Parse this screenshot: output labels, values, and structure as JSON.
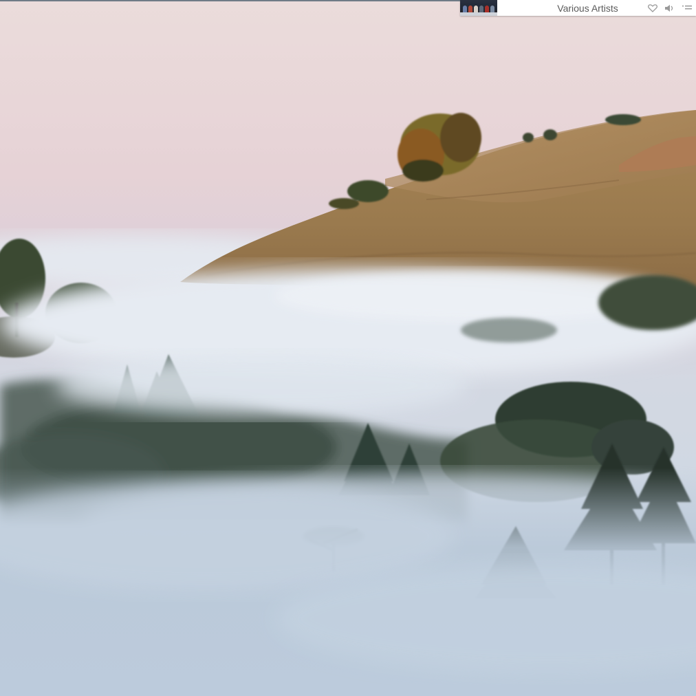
{
  "wallpaper": {
    "description_icon": "landscape-photo-icon"
  },
  "mini_player": {
    "artist": "Various Artists",
    "album_art_icon": "album-art-icon",
    "icons": [
      "heart-icon",
      "volume-icon",
      "queue-icon"
    ]
  }
}
